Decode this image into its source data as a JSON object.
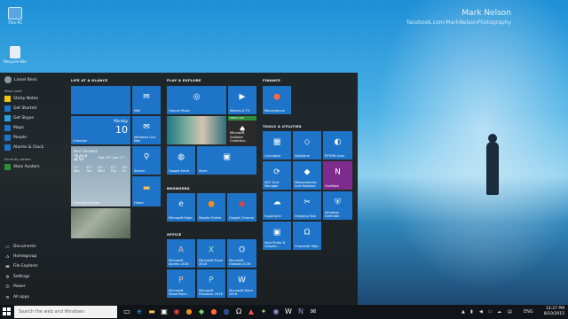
{
  "desktop": {
    "icons": [
      {
        "label": "This PC"
      },
      {
        "label": "Recycle Bin"
      }
    ],
    "watermark": {
      "name": "Mark Nelson",
      "url": "facebook.com/MarkNelsonPhotography"
    }
  },
  "start": {
    "user": "Lionel Beck",
    "most_used_label": "Most used",
    "most_used": [
      "Sticky Notes",
      "Get Started",
      "Get Skype",
      "Maps",
      "People",
      "Alarms & Clock"
    ],
    "recent_label": "Recently added",
    "recent": [
      "Xbox Avatars"
    ],
    "system": [
      "Documents",
      "Homegroup",
      "File Explorer",
      "Settings",
      "Power",
      "All apps"
    ],
    "groups": {
      "life": "LIFE AT A GLANCE",
      "play": "PLAY & EXPLORE",
      "finance": "FINANCE",
      "tools": "TOOLS & UTILITIES",
      "browsers": "BROWSERS",
      "office": "OFFICE"
    },
    "tiles": {
      "calendar": {
        "label": "Calendar",
        "day": "Monday",
        "date": "10"
      },
      "mail": "Mail",
      "live_mail": "Windows Live Mail",
      "weather": {
        "city": "Kent Showers",
        "temp": "20°",
        "hi_lo": "High 28° Low 17°",
        "location": "Thornton-le-Dale",
        "days": [
          "Mon",
          "Tue",
          "Wed",
          "Thu",
          "Fri"
        ],
        "temps": [
          "21°",
          "22°",
          "20°",
          "23°",
          "23°"
        ]
      },
      "search": "Search",
      "home": "Home",
      "groove": "Groove Music",
      "movies": "Movies & TV",
      "solitaire": "Microsoft Solitaire Collection",
      "xbox_badge": "XBOX LIVE",
      "google_earth": "Google Earth",
      "store": "Store",
      "moneydance": "Moneydance",
      "calculator": "Calculator",
      "dashlane": "Dashlane",
      "epson": "EPSON Scan",
      "wic": "WIC Sync Manager",
      "malwarebytes": "Malwarebytes Anti-Malware",
      "onenote": "OneNote",
      "sugarsync": "SugarSync",
      "snipping": "Snipping Tool",
      "defender": "Windows Defender",
      "xero": "Xero Photo & Graphic...",
      "charmap": "Character Map",
      "edge": "Microsoft Edge",
      "firefox": "Mozilla Firefox",
      "chrome": "Google Chrome",
      "access": "Microsoft Access 2016",
      "excel": "Microsoft Excel 2016",
      "outlook": "Microsoft Outlook 2016",
      "word": "Microsoft Word 2016",
      "powerpoint": "Microsoft PowerPoint...",
      "publisher": "Microsoft Publisher 2016",
      "skype": "Skype for Business",
      "onenote16": "OneNote"
    }
  },
  "taskbar": {
    "search_placeholder": "Search the web and Windows",
    "lang": "ENG",
    "time": "12:27 PM",
    "date": "8/10/2015"
  },
  "colors": {
    "accent": "#1e74c8",
    "start_bg": "#1c1c1c",
    "onenote": "#7e2b8e"
  }
}
